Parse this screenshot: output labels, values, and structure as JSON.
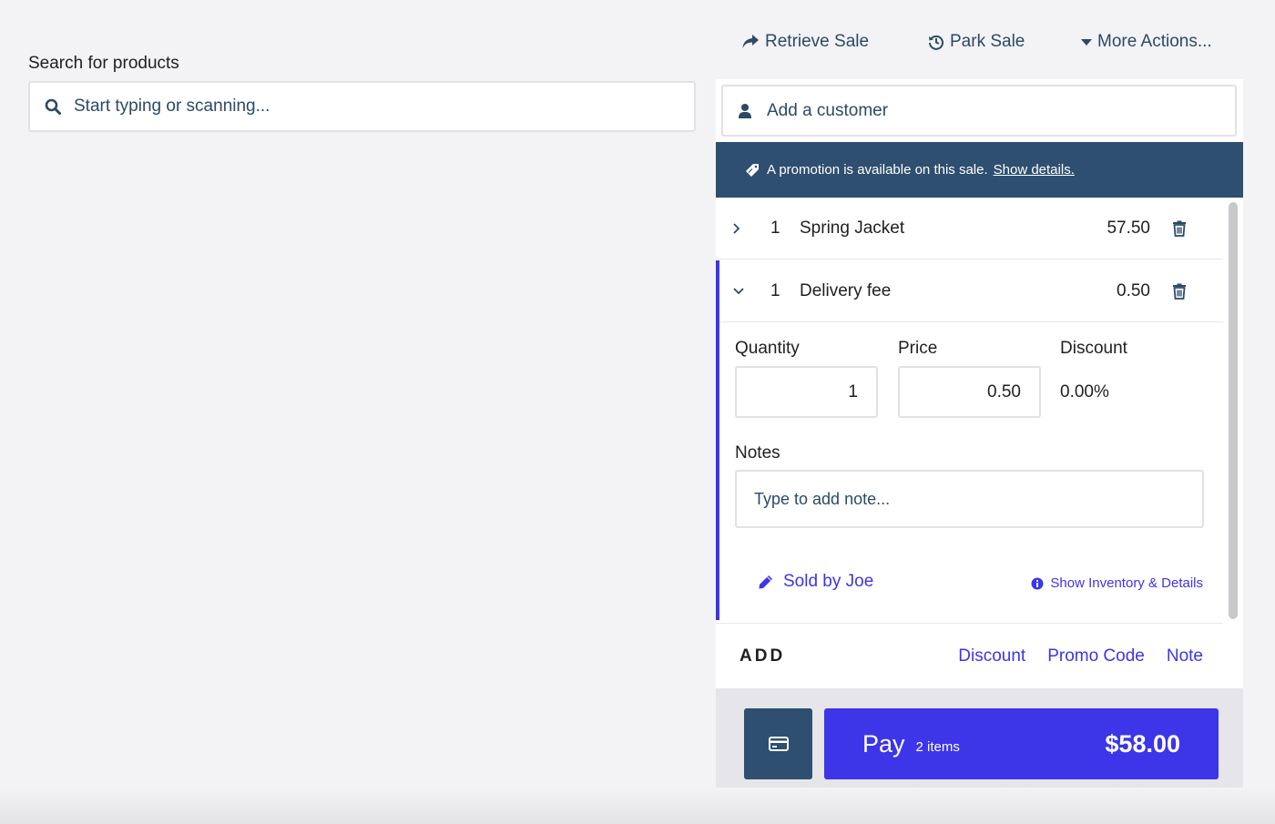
{
  "top_actions": {
    "retrieve_sale": "Retrieve Sale",
    "park_sale": "Park Sale",
    "more_actions": "More Actions..."
  },
  "search": {
    "label": "Search for products",
    "placeholder": "Start typing or scanning..."
  },
  "customer": {
    "placeholder": "Add a customer"
  },
  "promo": {
    "text": "A promotion is available on this sale.",
    "link": "Show details."
  },
  "items": [
    {
      "qty": "1",
      "name": "Spring Jacket",
      "price": "57.50",
      "expanded": false
    },
    {
      "qty": "1",
      "name": "Delivery fee",
      "price": "0.50",
      "expanded": true
    }
  ],
  "details": {
    "quantity_label": "Quantity",
    "price_label": "Price",
    "discount_label": "Discount",
    "quantity_value": "1",
    "price_value": "0.50",
    "discount_value": "0.00%",
    "notes_label": "Notes",
    "notes_placeholder": "Type to add note...",
    "sold_by": "Sold by Joe",
    "show_inventory": "Show Inventory & Details"
  },
  "add": {
    "label": "ADD",
    "discount": "Discount",
    "promo_code": "Promo Code",
    "note": "Note"
  },
  "pay": {
    "label": "Pay",
    "items": "2 items",
    "total": "$58.00"
  },
  "colors": {
    "accent": "#3d35e8",
    "navy": "#2e4f70",
    "link_navy": "#2b4a66"
  }
}
